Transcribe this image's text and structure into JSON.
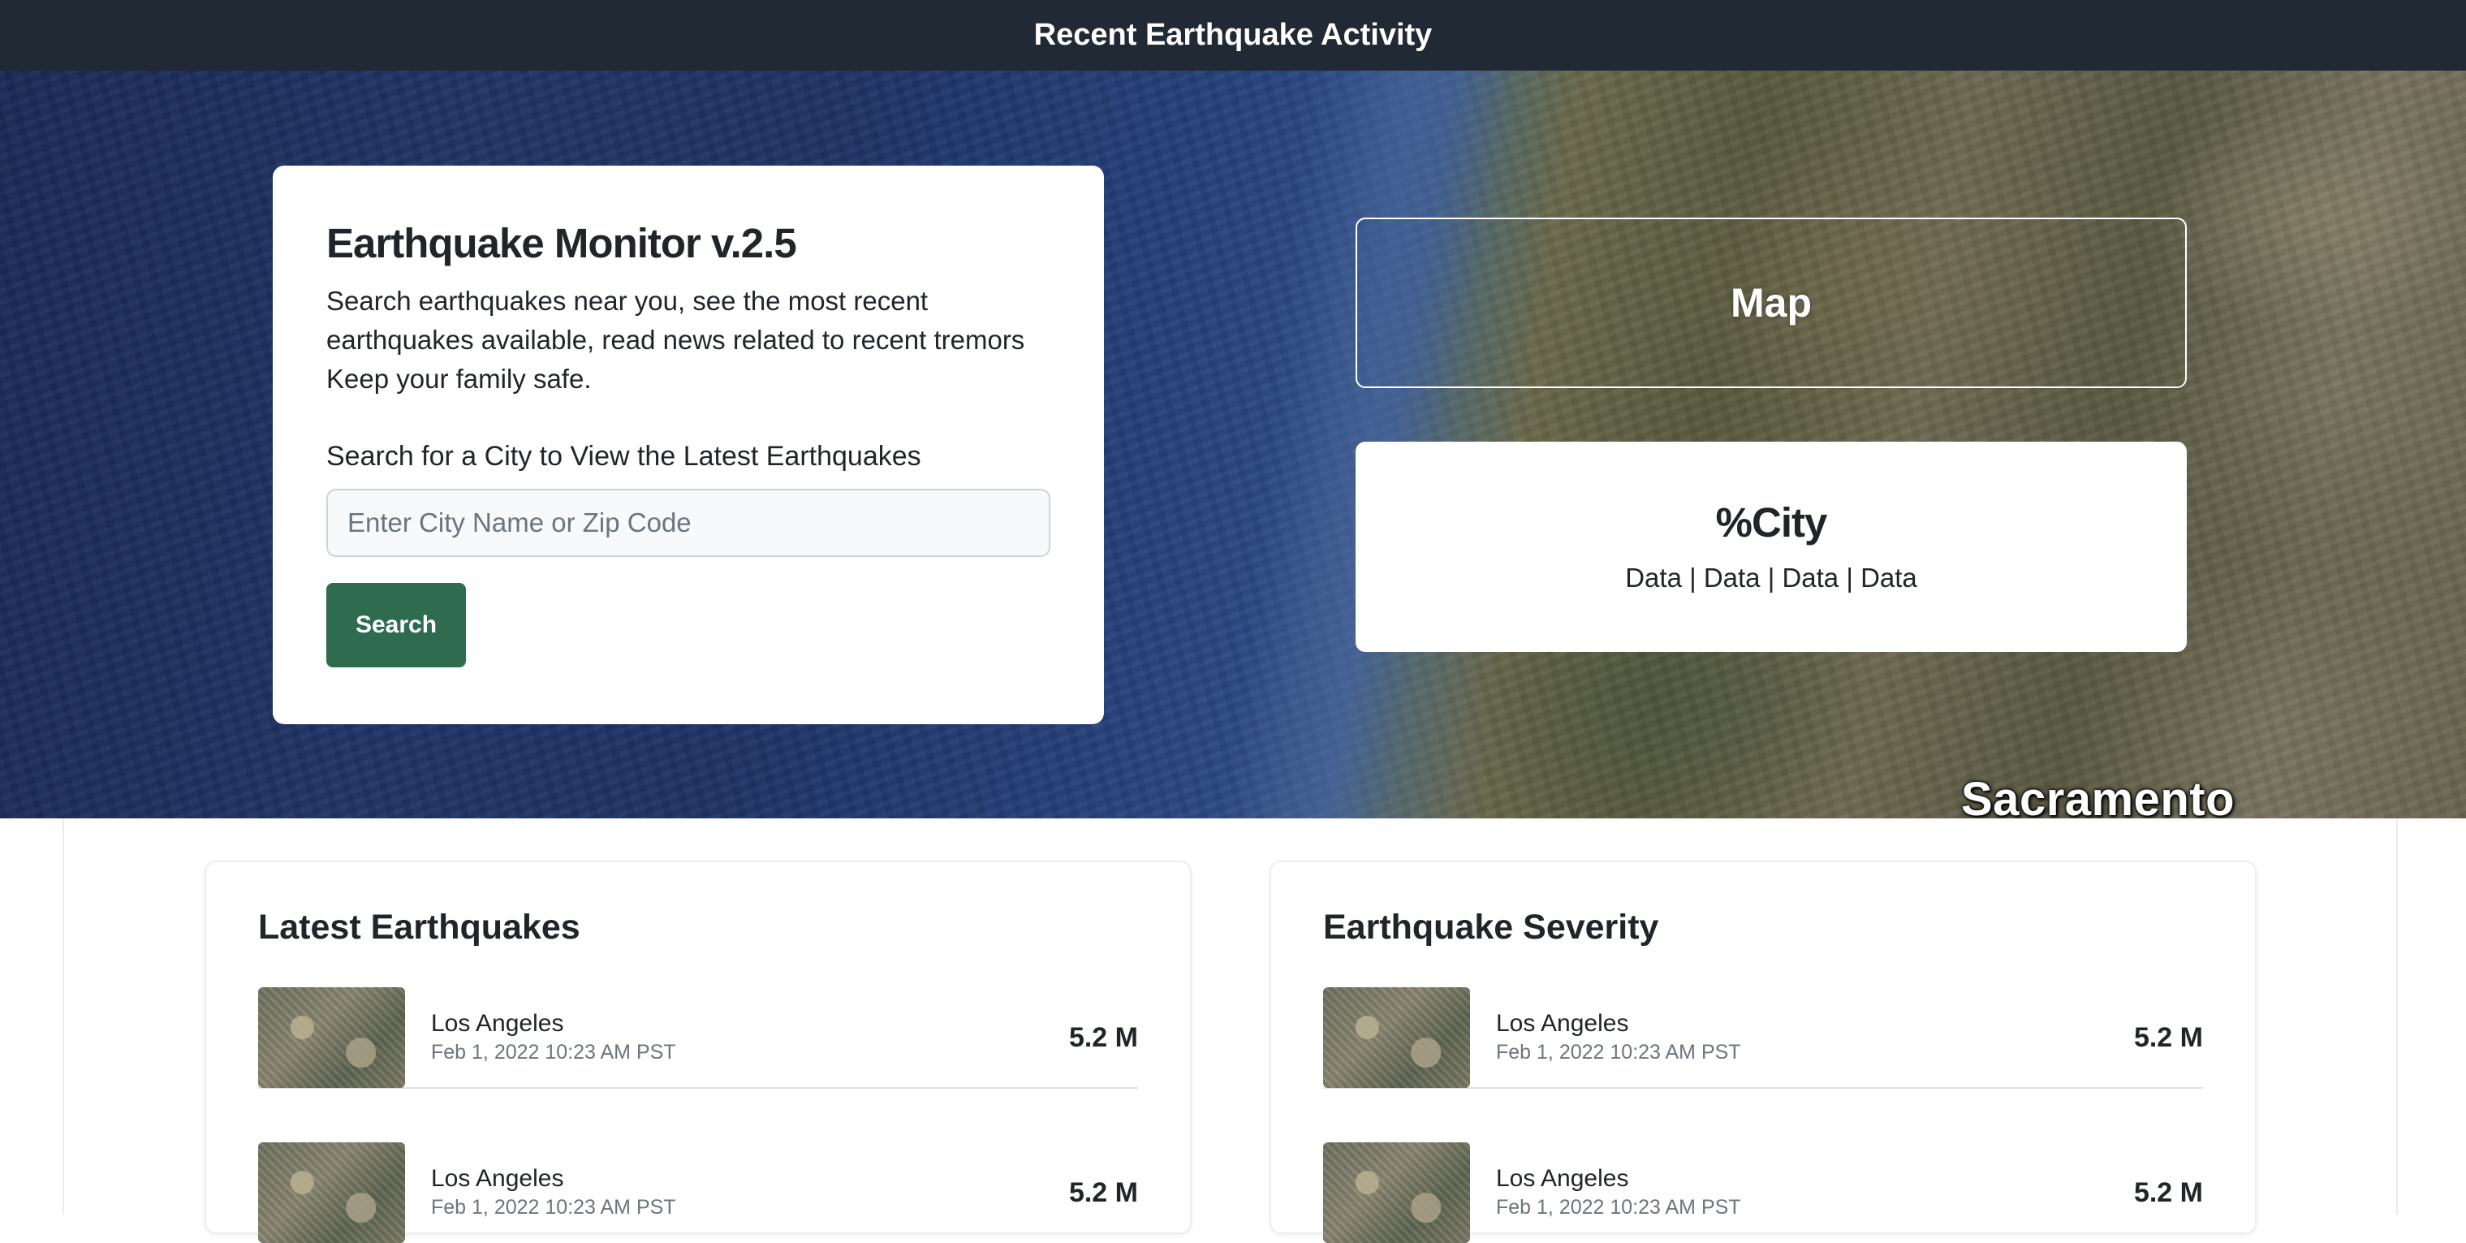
{
  "navbar": {
    "title": "Recent Earthquake Activity"
  },
  "hero": {
    "map_place_label": "Sacramento"
  },
  "search_card": {
    "title": "Earthquake Monitor v.2.5",
    "description_lines": [
      "Search earthquakes near you, see the most recent",
      "earthquakes available, read news related to recent tremors",
      "Keep your family safe."
    ],
    "search_label": "Search for a City to View the Latest Earthquakes",
    "input_placeholder": "Enter City Name or Zip Code",
    "input_value": "",
    "button_label": "Search"
  },
  "map_box": {
    "label": "Map"
  },
  "city_card": {
    "name": "%City",
    "data_line": "Data | Data | Data | Data"
  },
  "latest": {
    "title": "Latest Earthquakes",
    "items": [
      {
        "city": "Los Angeles",
        "time": "Feb 1, 2022 10:23 AM PST",
        "magnitude": "5.2 M"
      },
      {
        "city": "Los Angeles",
        "time": "Feb 1, 2022 10:23 AM PST",
        "magnitude": "5.2 M"
      }
    ]
  },
  "severity": {
    "title": "Earthquake Severity",
    "items": [
      {
        "city": "Los Angeles",
        "time": "Feb 1, 2022 10:23 AM PST",
        "magnitude": "5.2 M"
      },
      {
        "city": "Los Angeles",
        "time": "Feb 1, 2022 10:23 AM PST",
        "magnitude": "5.2 M"
      }
    ]
  },
  "colors": {
    "navbar_bg": "#212935",
    "button_bg": "#2e6b4f"
  }
}
